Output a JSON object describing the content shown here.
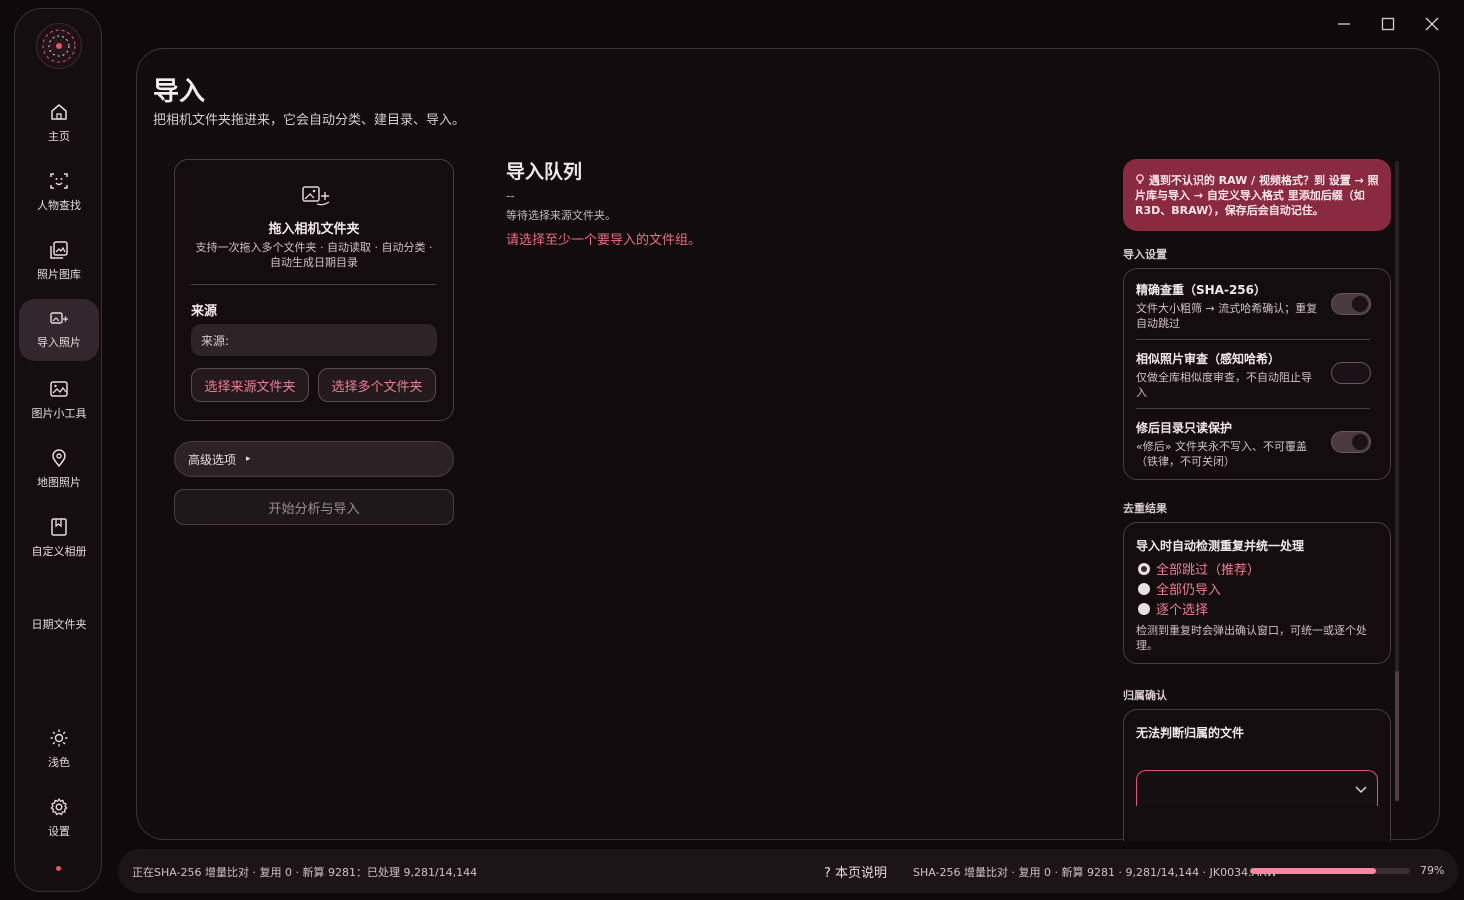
{
  "window": {
    "controls": [
      "minimize-icon",
      "maximize-icon",
      "close-icon"
    ]
  },
  "sidebar": {
    "items": [
      {
        "label": "主页",
        "icon": "home-icon"
      },
      {
        "label": "人物查找",
        "icon": "face-scan-icon"
      },
      {
        "label": "照片图库",
        "icon": "gallery-icon"
      },
      {
        "label": "导入照片",
        "icon": "import-photo-icon",
        "active": true
      },
      {
        "label": "图片小工具",
        "icon": "image-tool-icon"
      },
      {
        "label": "地图照片",
        "icon": "map-pin-icon"
      },
      {
        "label": "自定义相册",
        "icon": "album-icon"
      },
      {
        "label": "日期文件夹",
        "icon": ""
      },
      {
        "label": "浅色",
        "icon": "sun-icon"
      },
      {
        "label": "设置",
        "icon": "gear-icon"
      }
    ]
  },
  "page": {
    "title": "导入",
    "subtitle": "把相机文件夹拖进来，它会自动分类、建目录、导入。"
  },
  "drop": {
    "title": "拖入相机文件夹",
    "desc": "支持一次拖入多个文件夹 · 自动读取 · 自动分类 · 自动生成日期目录",
    "source_label": "来源",
    "source_value": "来源:",
    "btn_source": "选择来源文件夹",
    "btn_multi": "选择多个文件夹"
  },
  "advanced": {
    "label": "高级选项",
    "arrow": "▸"
  },
  "start": {
    "label": "开始分析与导入"
  },
  "queue": {
    "title": "导入队列",
    "dash": "--",
    "waiting": "等待选择来源文件夹。",
    "warning": "请选择至少一个要导入的文件组。"
  },
  "notice": {
    "text": "遇到不认识的 RAW / 视频格式？到 设置 → 照片库与导入 → 自定义导入格式 里添加后缀（如 R3D、BRAW），保存后会自动记住。"
  },
  "import_settings": {
    "label": "导入设置",
    "rows": [
      {
        "title": "精确查重（SHA-256）",
        "desc": "文件大小粗筛 → 流式哈希确认；重复自动跳过",
        "on": true
      },
      {
        "title": "相似照片审查（感知哈希）",
        "desc": "仅做全库相似度审查，不自动阻止导入",
        "on": false
      },
      {
        "title": "修后目录只读保护",
        "desc": "«修后» 文件夹永不写入、不可覆盖（铁律，不可关闭）",
        "on": true
      }
    ]
  },
  "dedup": {
    "label": "去重结果",
    "title": "导入时自动检测重复并统一处理",
    "options": [
      {
        "label": "全部跳过（推荐）",
        "checked": true
      },
      {
        "label": "全部仍导入",
        "checked": false
      },
      {
        "label": "逐个选择",
        "checked": false
      }
    ],
    "note": "检测到重复时会弹出确认窗口，可统一或逐个处理。"
  },
  "ownership": {
    "label": "归属确认",
    "title": "无法判断归属的文件"
  },
  "status": {
    "left": "正在SHA-256 增量比对 · 复用 0 · 新算 9281：已处理 9,281/14,144",
    "help": "? 本页说明",
    "right": "SHA-256 增量比对 · 复用 0 · 新算 9281 · 9,281/14,144 · JK0034.ARW",
    "progress": 79,
    "progress_label": "79%"
  },
  "colors": {
    "accent": "#e8546d",
    "link": "#ee7d92",
    "notice_bg": "#8a2a40",
    "bg": "#0e0a0c"
  }
}
